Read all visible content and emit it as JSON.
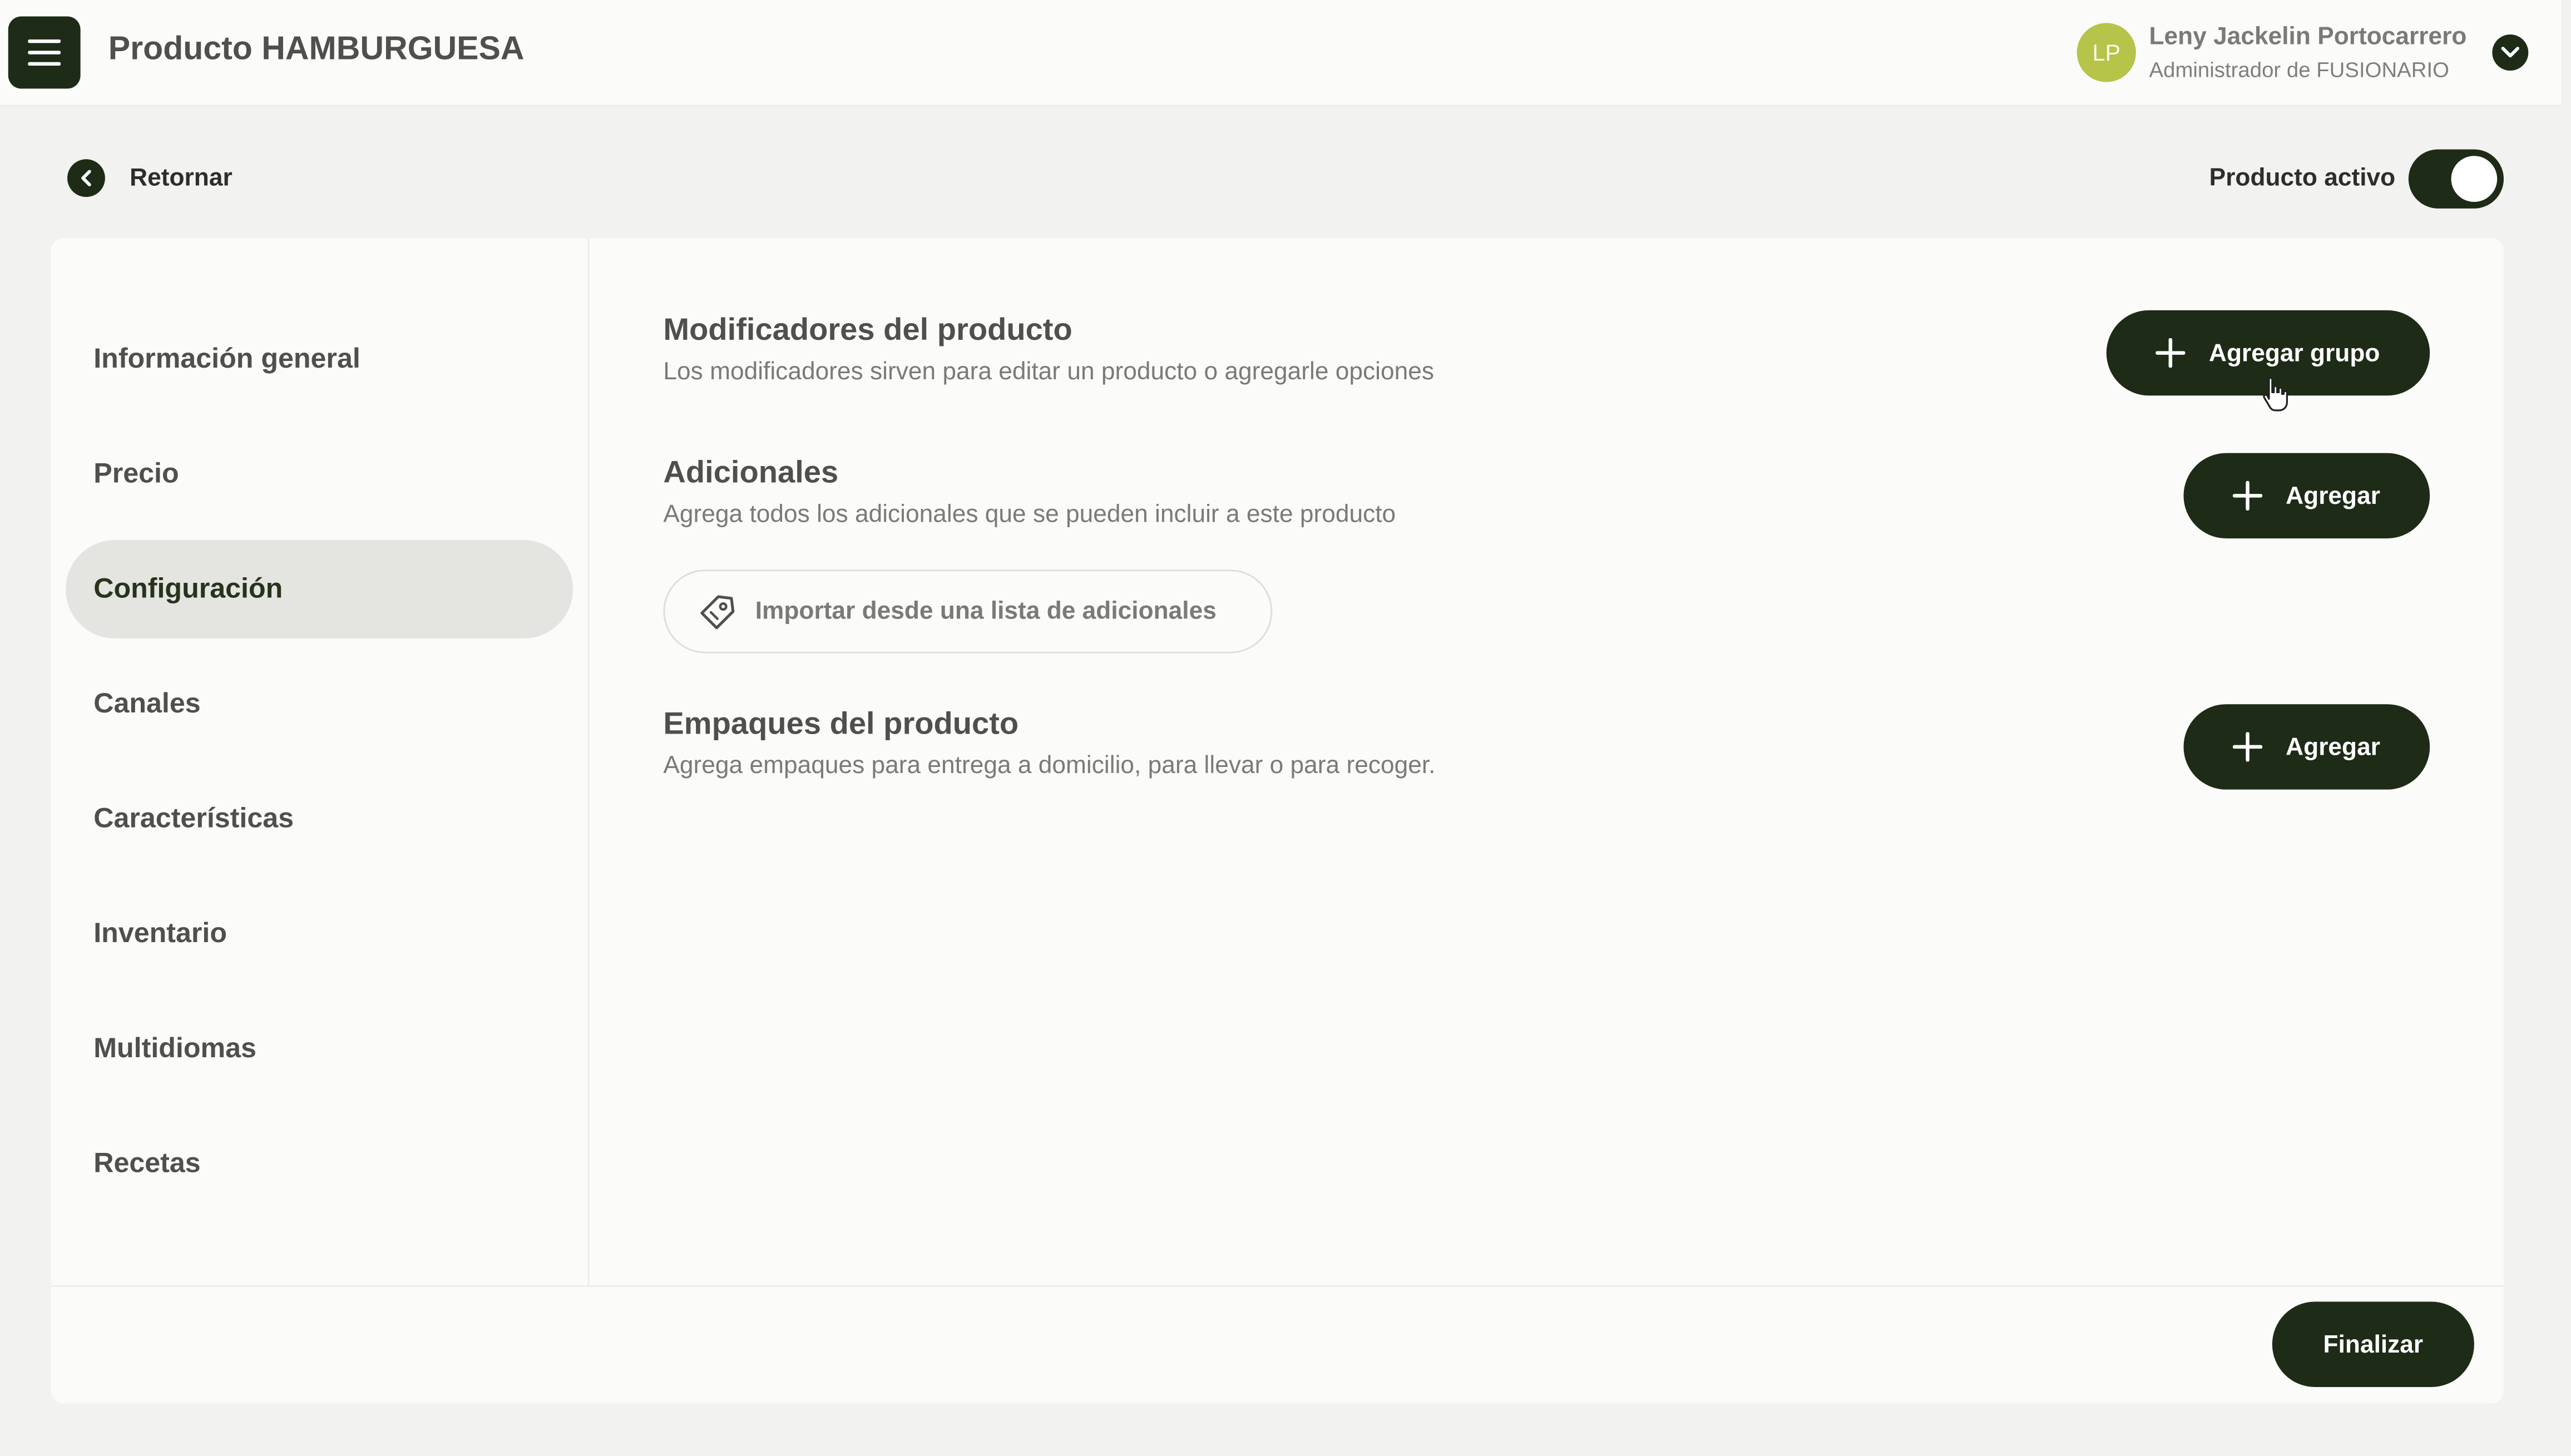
{
  "header": {
    "title": "Producto HAMBURGUESA",
    "user": {
      "initials": "LP",
      "name": "Leny Jackelin Portocarrero",
      "role": "Administrador de FUSIONARIO"
    }
  },
  "subheader": {
    "back_label": "Retornar",
    "active_label": "Producto activo",
    "active": true
  },
  "sidebar": {
    "items": [
      {
        "label": "Información general",
        "active": false
      },
      {
        "label": "Precio",
        "active": false
      },
      {
        "label": "Configuración",
        "active": true
      },
      {
        "label": "Canales",
        "active": false
      },
      {
        "label": "Características",
        "active": false
      },
      {
        "label": "Inventario",
        "active": false
      },
      {
        "label": "Multidiomas",
        "active": false
      },
      {
        "label": "Recetas",
        "active": false
      }
    ]
  },
  "main": {
    "modifiers": {
      "title": "Modificadores del producto",
      "description": "Los modificadores sirven para editar un producto o agregarle opciones",
      "button_label": "Agregar grupo"
    },
    "additionals": {
      "title": "Adicionales",
      "description": "Agrega todos los adicionales que se pueden incluir a este producto",
      "button_label": "Agregar",
      "import_label": "Importar desde una lista de adicionales"
    },
    "packaging": {
      "title": "Empaques del producto",
      "description": "Agrega empaques para entrega a domicilio, para llevar o para recoger.",
      "button_label": "Agregar"
    }
  },
  "footer": {
    "finalize_label": "Finalizar"
  },
  "colors": {
    "primary": "#1e2b17",
    "avatar": "#b6c44a",
    "active_nav": "#e4e5e1",
    "background": "#f2f2f0",
    "surface": "#fbfbf9"
  },
  "icons": {
    "menu": "menu-icon",
    "chevron": "chevron-down-icon",
    "back": "chevron-left-icon",
    "plus": "plus-icon",
    "tag": "tag-icon",
    "cursor": "hand-cursor-icon"
  }
}
